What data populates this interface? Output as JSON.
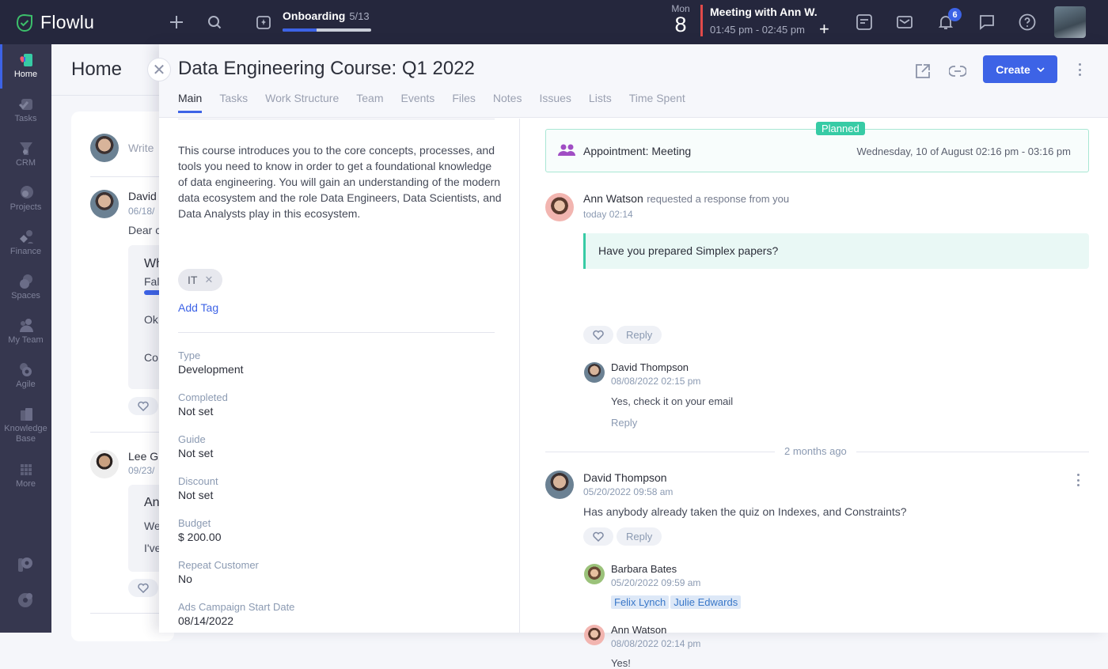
{
  "topbar": {
    "logo_text": "Flowlu",
    "onboarding": {
      "title": "Onboarding",
      "count": "5/13",
      "progress": 0.385
    },
    "calendar": {
      "day_name": "Mon",
      "day_number": "8"
    },
    "meeting": {
      "title": "Meeting with Ann W.",
      "time": "01:45 pm - 02:45 pm"
    },
    "notification_count": "6",
    "icons": [
      "plus-icon",
      "search-icon",
      "onboarding-icon",
      "notes-icon",
      "mail-icon",
      "bell-icon",
      "chat-icon",
      "help-icon"
    ]
  },
  "sidebar": {
    "items": [
      {
        "label": "Home",
        "icon": "home-icon",
        "active": true
      },
      {
        "label": "Tasks",
        "icon": "tasks-icon"
      },
      {
        "label": "CRM",
        "icon": "crm-icon"
      },
      {
        "label": "Projects",
        "icon": "projects-icon"
      },
      {
        "label": "Finance",
        "icon": "finance-icon"
      },
      {
        "label": "Spaces",
        "icon": "spaces-icon"
      },
      {
        "label": "My Team",
        "icon": "team-icon"
      },
      {
        "label": "Agile",
        "icon": "agile-icon"
      },
      {
        "label": "Knowledge Base",
        "icon": "knowledge-base-icon"
      },
      {
        "label": "More",
        "icon": "more-grid-icon"
      }
    ]
  },
  "home": {
    "title": "Home",
    "write_placeholder": "Write",
    "posts": [
      {
        "author": "David",
        "date": "06/18/",
        "text": "Dear c",
        "card_title": "Wh",
        "card_sub": "Fal",
        "lines": [
          "Ok",
          "Co"
        ]
      },
      {
        "author": "Lee G",
        "date": "09/23/",
        "card_title": "An",
        "lines": [
          "We",
          "I've"
        ]
      }
    ]
  },
  "panel": {
    "title": "Data Engineering Course: Q1 2022",
    "tabs": [
      "Main",
      "Tasks",
      "Work Structure",
      "Team",
      "Events",
      "Files",
      "Notes",
      "Issues",
      "Lists",
      "Time Spent"
    ],
    "active_tab": "Main",
    "create_label": "Create",
    "description": "This course introduces you to the core concepts, processes, and tools you need to know in order to get a foundational knowledge of data engineering. You will gain an understanding of the modern data ecosystem and the role Data Engineers, Data Scientists, and Data Analysts play in this ecosystem.",
    "tags": [
      "IT"
    ],
    "add_tag_label": "Add Tag",
    "fields": [
      {
        "label": "Type",
        "value": "Development"
      },
      {
        "label": "Completed",
        "value": "Not set"
      },
      {
        "label": "Guide",
        "value": "Not set"
      },
      {
        "label": "Discount",
        "value": "Not set"
      },
      {
        "label": "Budget",
        "value": "$ 200.00"
      },
      {
        "label": "Repeat Customer",
        "value": "No"
      },
      {
        "label": "Ads Campaign Start Date",
        "value": "08/14/2022"
      }
    ]
  },
  "activity": {
    "appointment": {
      "status": "Planned",
      "title": "Appointment: Meeting",
      "date": "Wednesday, 10 of August 02:16 pm - 03:16 pm"
    },
    "comments": [
      {
        "author": "Ann Watson",
        "action": "requested a response from you",
        "time": "today 02:14",
        "quote": "Have you prepared Simplex papers?",
        "replies": [
          {
            "author": "David Thompson",
            "time": "08/08/2022 02:15 pm",
            "text": "Yes, check it on your email"
          }
        ]
      },
      {
        "author": "David Thompson",
        "time": "05/20/2022 09:58 am",
        "text": "Has anybody already taken the quiz on Indexes, and Constraints?",
        "replies": [
          {
            "author": "Barbara Bates",
            "time": "05/20/2022 09:59 am",
            "mentions": [
              "Felix Lynch",
              "Julie Edwards"
            ]
          },
          {
            "author": "Ann Watson",
            "time": "08/08/2022 02:14 pm",
            "text": "Yes!"
          }
        ]
      }
    ],
    "separator": "2 months ago",
    "reply_label": "Reply"
  },
  "colors": {
    "accent": "#3d63e6",
    "topbar": "#25273d",
    "sidebar": "#36374f",
    "planned": "#37cba5",
    "meeting_marker": "#e04a4a"
  }
}
